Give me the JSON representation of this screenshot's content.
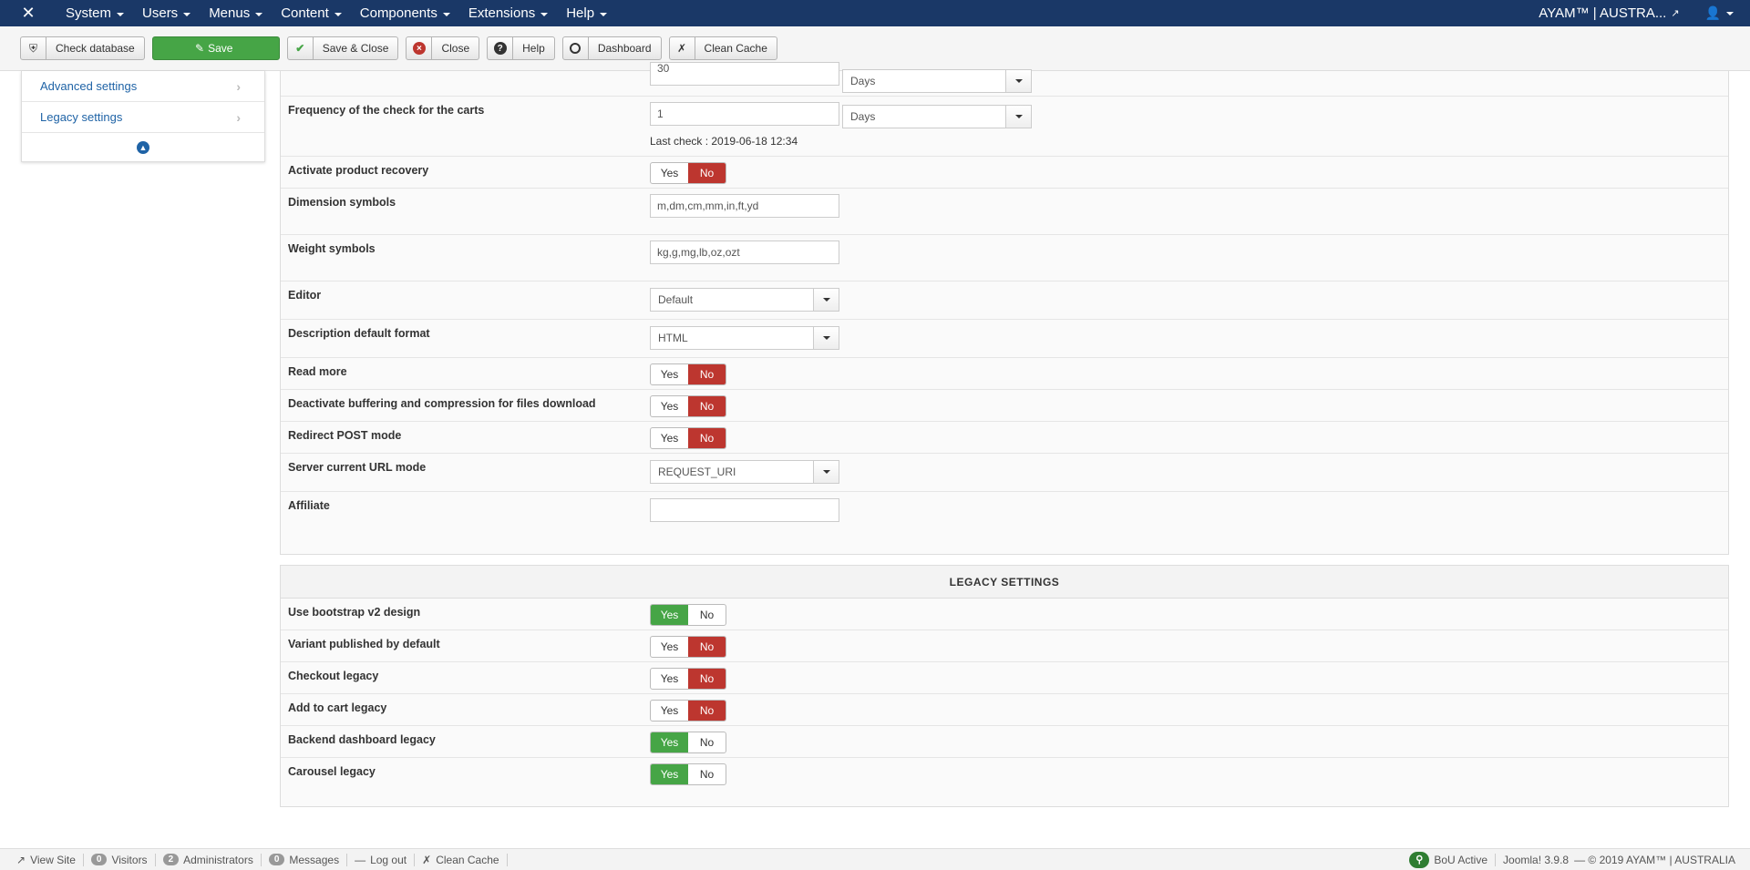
{
  "navbar": {
    "logo_icon": "joomla-icon",
    "menus": [
      "System",
      "Users",
      "Menus",
      "Content",
      "Components",
      "Extensions",
      "Help"
    ],
    "site_name": "AYAM™ | AUSTRA...",
    "user_icon": "user-icon"
  },
  "toolbar": {
    "check_database": "Check database",
    "save": "Save",
    "save_close": "Save & Close",
    "close": "Close",
    "help": "Help",
    "dashboard": "Dashboard",
    "clean_cache": "Clean Cache"
  },
  "sidebar": {
    "items": [
      {
        "label": "Advanced settings"
      },
      {
        "label": "Legacy settings"
      }
    ]
  },
  "top_partial": {
    "input_value": "30",
    "unit": "Days"
  },
  "settings": {
    "freq_carts": {
      "label": "Frequency of the check for the carts",
      "value": "1",
      "unit": "Days",
      "last_check": "Last check : 2019-06-18 12:34"
    },
    "product_recovery": {
      "label": "Activate product recovery",
      "yes": "Yes",
      "no": "No",
      "selected": "No"
    },
    "dimension_symbols": {
      "label": "Dimension symbols",
      "value": "m,dm,cm,mm,in,ft,yd"
    },
    "weight_symbols": {
      "label": "Weight symbols",
      "value": "kg,g,mg,lb,oz,ozt"
    },
    "editor": {
      "label": "Editor",
      "value": "Default"
    },
    "desc_format": {
      "label": "Description default format",
      "value": "HTML"
    },
    "read_more": {
      "label": "Read more",
      "yes": "Yes",
      "no": "No",
      "selected": "No"
    },
    "deactivate_buffering": {
      "label": "Deactivate buffering and compression for files download",
      "yes": "Yes",
      "no": "No",
      "selected": "No"
    },
    "redirect_post": {
      "label": "Redirect POST mode",
      "yes": "Yes",
      "no": "No",
      "selected": "No"
    },
    "server_url_mode": {
      "label": "Server current URL mode",
      "value": "REQUEST_URI"
    },
    "affiliate": {
      "label": "Affiliate",
      "value": ""
    }
  },
  "legacy": {
    "header": "LEGACY SETTINGS",
    "rows": [
      {
        "label": "Use bootstrap v2 design",
        "yes": "Yes",
        "no": "No",
        "selected": "Yes"
      },
      {
        "label": "Variant published by default",
        "yes": "Yes",
        "no": "No",
        "selected": "No"
      },
      {
        "label": "Checkout legacy",
        "yes": "Yes",
        "no": "No",
        "selected": "No"
      },
      {
        "label": "Add to cart legacy",
        "yes": "Yes",
        "no": "No",
        "selected": "No"
      },
      {
        "label": "Backend dashboard legacy",
        "yes": "Yes",
        "no": "No",
        "selected": "Yes"
      },
      {
        "label": "Carousel legacy",
        "yes": "Yes",
        "no": "No",
        "selected": "Yes"
      }
    ]
  },
  "statusbar": {
    "view_site": "View Site",
    "visitors_count": "0",
    "visitors": "Visitors",
    "admins_count": "2",
    "admins": "Administrators",
    "messages_count": "0",
    "messages": "Messages",
    "logout": "Log out",
    "clean_cache": "Clean Cache",
    "bou": "BoU Active",
    "version": "Joomla! 3.9.8",
    "copyright": "— © 2019 AYAM™ | AUSTRALIA"
  },
  "colors": {
    "navbar": "#1a3867",
    "save_green": "#46a546",
    "no_red": "#bd362f",
    "link_blue": "#1f63a6"
  }
}
